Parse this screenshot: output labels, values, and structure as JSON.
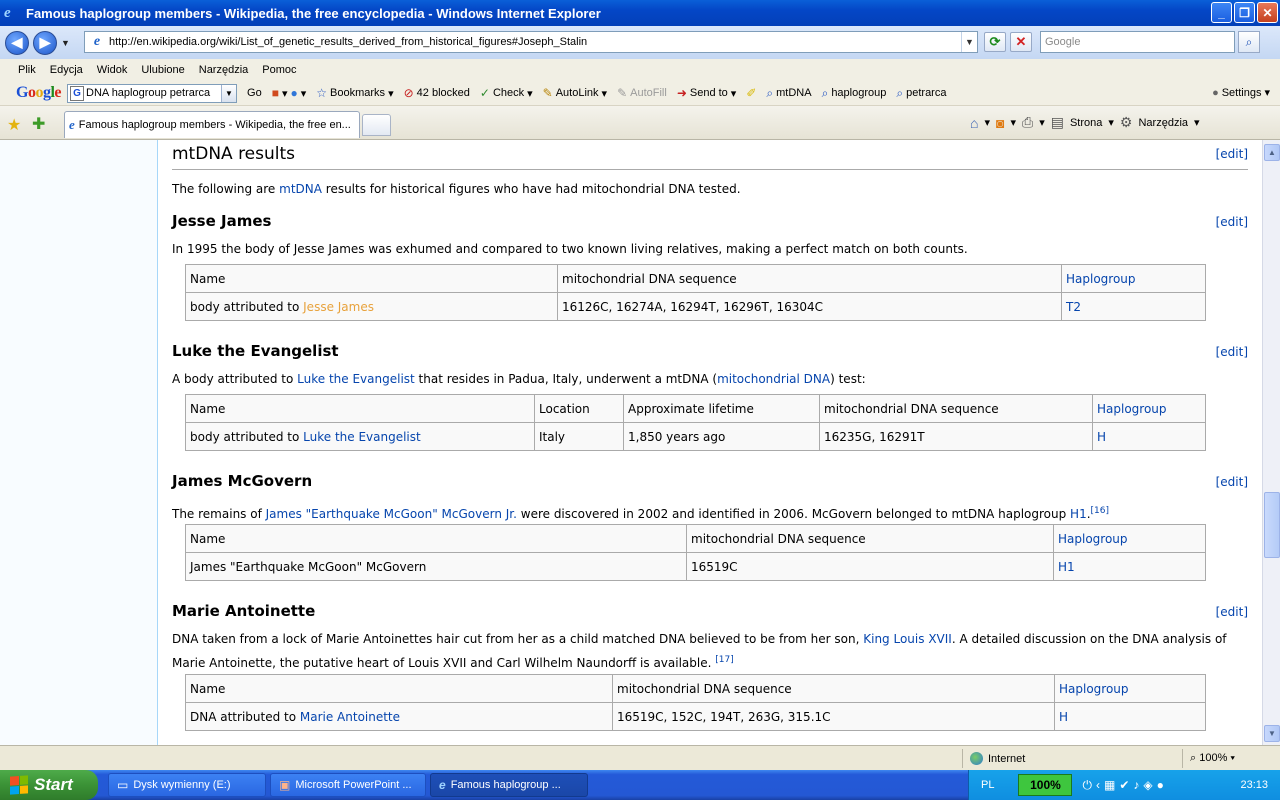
{
  "window": {
    "title": "Famous haplogroup members - Wikipedia, the free encyclopedia - Windows Internet Explorer"
  },
  "address": {
    "url": "http://en.wikipedia.org/wiki/List_of_genetic_results_derived_from_historical_figures#Joseph_Stalin",
    "search_placeholder": "Google"
  },
  "menu": [
    "Plik",
    "Edycja",
    "Widok",
    "Ulubione",
    "Narzędzia",
    "Pomoc"
  ],
  "google_toolbar": {
    "search_value": "DNA haplogroup petrarca",
    "go": "Go",
    "bookmarks": "Bookmarks",
    "blocked": "42 blocked",
    "check": "Check",
    "autolink": "AutoLink",
    "autofill": "AutoFill",
    "sendto": "Send to",
    "b_mtdna": "mtDNA",
    "b_haplogroup": "haplogroup",
    "b_petrarca": "petrarca",
    "settings": "Settings"
  },
  "tabs": {
    "active": "Famous haplogroup members - Wikipedia, the free en...",
    "strona": "Strona",
    "narzedzia": "Narzędzia"
  },
  "article": {
    "section_title": "mtDNA results",
    "edit": "[edit]",
    "intro_pre": "The following are ",
    "intro_link": "mtDNA",
    "intro_post": " results for historical figures who have had mitochondrial DNA tested.",
    "jj": {
      "heading": "Jesse James",
      "text": "In 1995 the body of Jesse James was exhumed and compared to two known living relatives, making a perfect match on both counts.",
      "headers": [
        "Name",
        "mitochondrial DNA sequence",
        "Haplogroup"
      ],
      "row_prefix": "body attributed to ",
      "row_link": "Jesse James",
      "sequence": "16126C, 16274A, 16294T, 16296T, 16304C",
      "haplogroup": "T2"
    },
    "luke": {
      "heading": "Luke the Evangelist",
      "text_pre": "A body attributed to ",
      "text_link1": "Luke the Evangelist",
      "text_mid": " that resides in Padua, Italy, underwent a mtDNA (",
      "text_link2": "mitochondrial DNA",
      "text_post": ") test:",
      "headers": [
        "Name",
        "Location",
        "Approximate lifetime",
        "mitochondrial DNA sequence",
        "Haplogroup"
      ],
      "row_prefix": "body attributed to ",
      "row_link": "Luke the Evangelist",
      "location": "Italy",
      "lifetime": "1,850 years ago",
      "sequence": "16235G, 16291T",
      "haplogroup": "H"
    },
    "mcgovern": {
      "heading": "James McGovern",
      "text_pre": "The remains of ",
      "text_link": "James \"Earthquake McGoon\" McGovern Jr.",
      "text_mid": " were discovered in 2002 and identified in 2006. McGovern belonged to mtDNA haplogroup ",
      "text_link2": "H1",
      "text_end": ".",
      "ref": "[16]",
      "headers": [
        "Name",
        "mitochondrial DNA sequence",
        "Haplogroup"
      ],
      "name": "James \"Earthquake McGoon\" McGovern",
      "sequence": "16519C",
      "haplogroup": "H1"
    },
    "marie": {
      "heading": "Marie Antoinette",
      "text_pre": "DNA taken from a lock of Marie Antoinettes hair cut from her as a child matched DNA believed to be from her son, ",
      "text_link": "King Louis XVII",
      "text_post": ". A detailed discussion on the DNA analysis of Marie Antoinette, the putative heart of Louis XVII and Carl Wilhelm Naundorff is available. ",
      "ref": "[17]",
      "headers": [
        "Name",
        "mitochondrial DNA sequence",
        "Haplogroup"
      ],
      "row_prefix": "DNA attributed to ",
      "row_link": "Marie Antoinette",
      "sequence": "16519C, 152C, 194T, 263G, 315.1C",
      "haplogroup": "H"
    }
  },
  "status": {
    "zone": "Internet",
    "zoom": "100%"
  },
  "taskbar": {
    "start": "Start",
    "t1": "Dysk wymienny (E:)",
    "t2": "Microsoft PowerPoint ...",
    "t3": "Famous haplogroup ...",
    "lang": "PL",
    "battery": "100%",
    "clock": "23:13"
  }
}
